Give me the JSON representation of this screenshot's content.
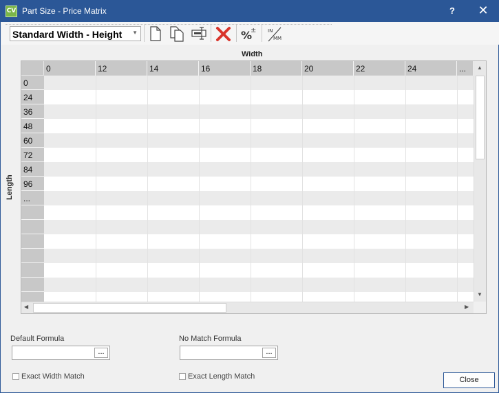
{
  "window": {
    "title": "Part Size - Price Matrix",
    "app_badge": "CV",
    "help": "?",
    "close": "✕"
  },
  "toolbar": {
    "matrix_type": "Standard Width - Height",
    "tools": [
      "new-icon",
      "copy-icon",
      "edit-icon",
      "delete-icon",
      "percent-adjust-icon",
      "unit-toggle-icon"
    ],
    "unit_toggle_label": "IN/MM",
    "accent_delete": "#d9342b"
  },
  "matrix": {
    "x_axis_label": "Width",
    "y_axis_label": "Length",
    "columns": [
      "0",
      "12",
      "14",
      "16",
      "18",
      "20",
      "22",
      "24",
      "..."
    ],
    "rows": [
      "0",
      "24",
      "36",
      "48",
      "60",
      "72",
      "84",
      "96",
      "...",
      "",
      "",
      "",
      "",
      "",
      "",
      ""
    ]
  },
  "formulas": {
    "default_label": "Default Formula",
    "default_value": "",
    "no_match_label": "No Match Formula",
    "no_match_value": "",
    "browse_label": "..."
  },
  "options": {
    "exact_width": "Exact Width Match",
    "exact_length": "Exact Length Match"
  },
  "buttons": {
    "close": "Close"
  },
  "colors": {
    "title_bar": "#2b5797",
    "header_gray": "#c8c8c8",
    "row_stripe": "#ebebeb"
  }
}
